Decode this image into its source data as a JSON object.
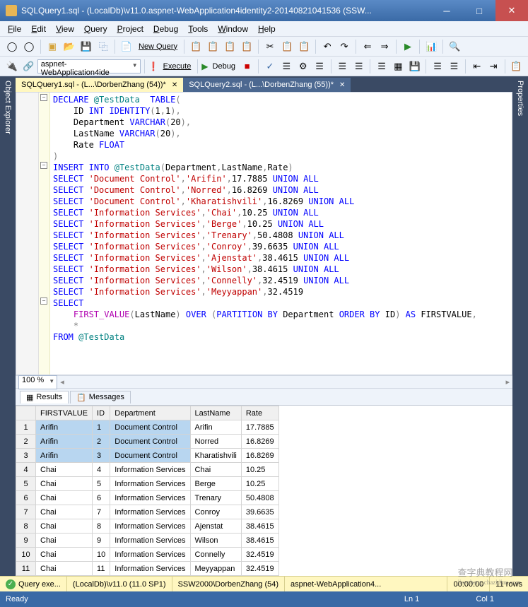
{
  "window": {
    "title": "SQLQuery1.sql - (LocalDb)\\v11.0.aspnet-WebApplication4identity2-20140821041536 (SSW..."
  },
  "menu": [
    "File",
    "Edit",
    "View",
    "Query",
    "Project",
    "Debug",
    "Tools",
    "Window",
    "Help"
  ],
  "toolbar1": {
    "newquery": "New Query"
  },
  "toolbar2": {
    "db": "aspnet-WebApplication4ide",
    "execute": "Execute",
    "debug": "Debug"
  },
  "sidebars": {
    "left": "Object Explorer",
    "right": "Properties"
  },
  "tabs": [
    {
      "label": "SQLQuery1.sql - (L...\\DorbenZhang (54))*",
      "active": true
    },
    {
      "label": "SQLQuery2.sql - (L...\\DorbenZhang (55))*",
      "active": false
    }
  ],
  "code_lines": [
    [
      [
        "kw",
        "DECLARE"
      ],
      [
        "",
        ""
      ],
      [
        "var",
        " @TestData"
      ],
      [
        "",
        "  "
      ],
      [
        "kw",
        "TABLE"
      ],
      [
        "gr",
        "("
      ]
    ],
    [
      [
        "",
        "    ID "
      ],
      [
        "kw",
        "INT"
      ],
      [
        "",
        " "
      ],
      [
        "kw",
        "IDENTITY"
      ],
      [
        "gr",
        "("
      ],
      [
        "",
        "1"
      ],
      [
        "gr",
        ","
      ],
      [
        "",
        "1"
      ],
      [
        "gr",
        ")"
      ],
      [
        "gr",
        ","
      ]
    ],
    [
      [
        "",
        "    Department "
      ],
      [
        "kw",
        "VARCHAR"
      ],
      [
        "gr",
        "("
      ],
      [
        "",
        "20"
      ],
      [
        "gr",
        ")"
      ],
      [
        "gr",
        ","
      ]
    ],
    [
      [
        "",
        "    LastName "
      ],
      [
        "kw",
        "VARCHAR"
      ],
      [
        "gr",
        "("
      ],
      [
        "",
        "20"
      ],
      [
        "gr",
        ")"
      ],
      [
        "gr",
        ","
      ]
    ],
    [
      [
        "",
        "    Rate "
      ],
      [
        "kw",
        "FLOAT"
      ]
    ],
    [
      [
        "gr",
        ")"
      ]
    ],
    [
      [
        "kw",
        "INSERT"
      ],
      [
        "",
        " "
      ],
      [
        "kw",
        "INTO"
      ],
      [
        "",
        " "
      ],
      [
        "var",
        "@TestData"
      ],
      [
        "gr",
        "("
      ],
      [
        "",
        "Department"
      ],
      [
        "gr",
        ","
      ],
      [
        "",
        "LastName"
      ],
      [
        "gr",
        ","
      ],
      [
        "",
        "Rate"
      ],
      [
        "gr",
        ")"
      ]
    ],
    [
      [
        "kw",
        "SELECT"
      ],
      [
        "",
        " "
      ],
      [
        "str",
        "'Document Control'"
      ],
      [
        "gr",
        ","
      ],
      [
        "str",
        "'Arifin'"
      ],
      [
        "gr",
        ","
      ],
      [
        "",
        "17.7885 "
      ],
      [
        "kw",
        "UNION"
      ],
      [
        "",
        " "
      ],
      [
        "kw",
        "ALL"
      ]
    ],
    [
      [
        "kw",
        "SELECT"
      ],
      [
        "",
        " "
      ],
      [
        "str",
        "'Document Control'"
      ],
      [
        "gr",
        ","
      ],
      [
        "str",
        "'Norred'"
      ],
      [
        "gr",
        ","
      ],
      [
        "",
        "16.8269 "
      ],
      [
        "kw",
        "UNION"
      ],
      [
        "",
        " "
      ],
      [
        "kw",
        "ALL"
      ]
    ],
    [
      [
        "kw",
        "SELECT"
      ],
      [
        "",
        " "
      ],
      [
        "str",
        "'Document Control'"
      ],
      [
        "gr",
        ","
      ],
      [
        "str",
        "'Kharatishvili'"
      ],
      [
        "gr",
        ","
      ],
      [
        "",
        "16.8269 "
      ],
      [
        "kw",
        "UNION"
      ],
      [
        "",
        " "
      ],
      [
        "kw",
        "ALL"
      ]
    ],
    [
      [
        "kw",
        "SELECT"
      ],
      [
        "",
        " "
      ],
      [
        "str",
        "'Information Services'"
      ],
      [
        "gr",
        ","
      ],
      [
        "str",
        "'Chai'"
      ],
      [
        "gr",
        ","
      ],
      [
        "",
        "10.25 "
      ],
      [
        "kw",
        "UNION"
      ],
      [
        "",
        " "
      ],
      [
        "kw",
        "ALL"
      ]
    ],
    [
      [
        "kw",
        "SELECT"
      ],
      [
        "",
        " "
      ],
      [
        "str",
        "'Information Services'"
      ],
      [
        "gr",
        ","
      ],
      [
        "str",
        "'Berge'"
      ],
      [
        "gr",
        ","
      ],
      [
        "",
        "10.25 "
      ],
      [
        "kw",
        "UNION"
      ],
      [
        "",
        " "
      ],
      [
        "kw",
        "ALL"
      ]
    ],
    [
      [
        "kw",
        "SELECT"
      ],
      [
        "",
        " "
      ],
      [
        "str",
        "'Information Services'"
      ],
      [
        "gr",
        ","
      ],
      [
        "str",
        "'Trenary'"
      ],
      [
        "gr",
        ","
      ],
      [
        "",
        "50.4808 "
      ],
      [
        "kw",
        "UNION"
      ],
      [
        "",
        " "
      ],
      [
        "kw",
        "ALL"
      ]
    ],
    [
      [
        "kw",
        "SELECT"
      ],
      [
        "",
        " "
      ],
      [
        "str",
        "'Information Services'"
      ],
      [
        "gr",
        ","
      ],
      [
        "str",
        "'Conroy'"
      ],
      [
        "gr",
        ","
      ],
      [
        "",
        "39.6635 "
      ],
      [
        "kw",
        "UNION"
      ],
      [
        "",
        " "
      ],
      [
        "kw",
        "ALL"
      ]
    ],
    [
      [
        "kw",
        "SELECT"
      ],
      [
        "",
        " "
      ],
      [
        "str",
        "'Information Services'"
      ],
      [
        "gr",
        ","
      ],
      [
        "str",
        "'Ajenstat'"
      ],
      [
        "gr",
        ","
      ],
      [
        "",
        "38.4615 "
      ],
      [
        "kw",
        "UNION"
      ],
      [
        "",
        " "
      ],
      [
        "kw",
        "ALL"
      ]
    ],
    [
      [
        "kw",
        "SELECT"
      ],
      [
        "",
        " "
      ],
      [
        "str",
        "'Information Services'"
      ],
      [
        "gr",
        ","
      ],
      [
        "str",
        "'Wilson'"
      ],
      [
        "gr",
        ","
      ],
      [
        "",
        "38.4615 "
      ],
      [
        "kw",
        "UNION"
      ],
      [
        "",
        " "
      ],
      [
        "kw",
        "ALL"
      ]
    ],
    [
      [
        "kw",
        "SELECT"
      ],
      [
        "",
        " "
      ],
      [
        "str",
        "'Information Services'"
      ],
      [
        "gr",
        ","
      ],
      [
        "str",
        "'Connelly'"
      ],
      [
        "gr",
        ","
      ],
      [
        "",
        "32.4519 "
      ],
      [
        "kw",
        "UNION"
      ],
      [
        "",
        " "
      ],
      [
        "kw",
        "ALL"
      ]
    ],
    [
      [
        "kw",
        "SELECT"
      ],
      [
        "",
        " "
      ],
      [
        "str",
        "'Information Services'"
      ],
      [
        "gr",
        ","
      ],
      [
        "str",
        "'Meyyappan'"
      ],
      [
        "gr",
        ","
      ],
      [
        "",
        "32.4519"
      ]
    ],
    [
      [
        "",
        ""
      ]
    ],
    [
      [
        "kw",
        "SELECT"
      ]
    ],
    [
      [
        "",
        "    "
      ],
      [
        "fn",
        "FIRST_VALUE"
      ],
      [
        "gr",
        "("
      ],
      [
        "",
        "LastName"
      ],
      [
        "gr",
        ")"
      ],
      [
        "",
        " "
      ],
      [
        "kw",
        "OVER"
      ],
      [
        "",
        " "
      ],
      [
        "gr",
        "("
      ],
      [
        "kw",
        "PARTITION"
      ],
      [
        "",
        " "
      ],
      [
        "kw",
        "BY"
      ],
      [
        "",
        " Department "
      ],
      [
        "kw",
        "ORDER"
      ],
      [
        "",
        " "
      ],
      [
        "kw",
        "BY"
      ],
      [
        "",
        " ID"
      ],
      [
        "gr",
        ")"
      ],
      [
        "",
        " "
      ],
      [
        "kw",
        "AS"
      ],
      [
        "",
        " FIRSTVALUE"
      ],
      [
        "gr",
        ","
      ]
    ],
    [
      [
        "",
        "    "
      ],
      [
        "gr",
        "*"
      ]
    ],
    [
      [
        "kw",
        "FROM"
      ],
      [
        "",
        " "
      ],
      [
        "var",
        "@TestData"
      ]
    ]
  ],
  "zoom": "100 %",
  "result_tabs": {
    "results": "Results",
    "messages": "Messages"
  },
  "grid": {
    "headers": [
      "",
      "FIRSTVALUE",
      "ID",
      "Department",
      "LastName",
      "Rate"
    ],
    "rows": [
      {
        "n": "1",
        "fv": "Arifin",
        "id": "1",
        "dep": "Document Control",
        "ln": "Arifin",
        "rate": "17.7885",
        "sel": true
      },
      {
        "n": "2",
        "fv": "Arifin",
        "id": "2",
        "dep": "Document Control",
        "ln": "Norred",
        "rate": "16.8269",
        "sel": true
      },
      {
        "n": "3",
        "fv": "Arifin",
        "id": "3",
        "dep": "Document Control",
        "ln": "Kharatishvili",
        "rate": "16.8269",
        "sel": true
      },
      {
        "n": "4",
        "fv": "Chai",
        "id": "4",
        "dep": "Information Services",
        "ln": "Chai",
        "rate": "10.25"
      },
      {
        "n": "5",
        "fv": "Chai",
        "id": "5",
        "dep": "Information Services",
        "ln": "Berge",
        "rate": "10.25"
      },
      {
        "n": "6",
        "fv": "Chai",
        "id": "6",
        "dep": "Information Services",
        "ln": "Trenary",
        "rate": "50.4808"
      },
      {
        "n": "7",
        "fv": "Chai",
        "id": "7",
        "dep": "Information Services",
        "ln": "Conroy",
        "rate": "39.6635"
      },
      {
        "n": "8",
        "fv": "Chai",
        "id": "8",
        "dep": "Information Services",
        "ln": "Ajenstat",
        "rate": "38.4615"
      },
      {
        "n": "9",
        "fv": "Chai",
        "id": "9",
        "dep": "Information Services",
        "ln": "Wilson",
        "rate": "38.4615"
      },
      {
        "n": "10",
        "fv": "Chai",
        "id": "10",
        "dep": "Information Services",
        "ln": "Connelly",
        "rate": "32.4519"
      },
      {
        "n": "11",
        "fv": "Chai",
        "id": "11",
        "dep": "Information Services",
        "ln": "Meyyappan",
        "rate": "32.4519"
      }
    ]
  },
  "status1": {
    "query": "Query exe...",
    "server": "(LocalDb)\\v11.0 (11.0 SP1)",
    "user": "SSW2000\\DorbenZhang (54)",
    "db": "aspnet-WebApplication4...",
    "time": "00:00:00",
    "rows": "11 rows"
  },
  "status2": {
    "ready": "Ready",
    "ln": "Ln 1",
    "col": "Col 1"
  },
  "watermark": {
    "big": "查字典教程网",
    "small": "jiaocheng.chazidian.com"
  }
}
